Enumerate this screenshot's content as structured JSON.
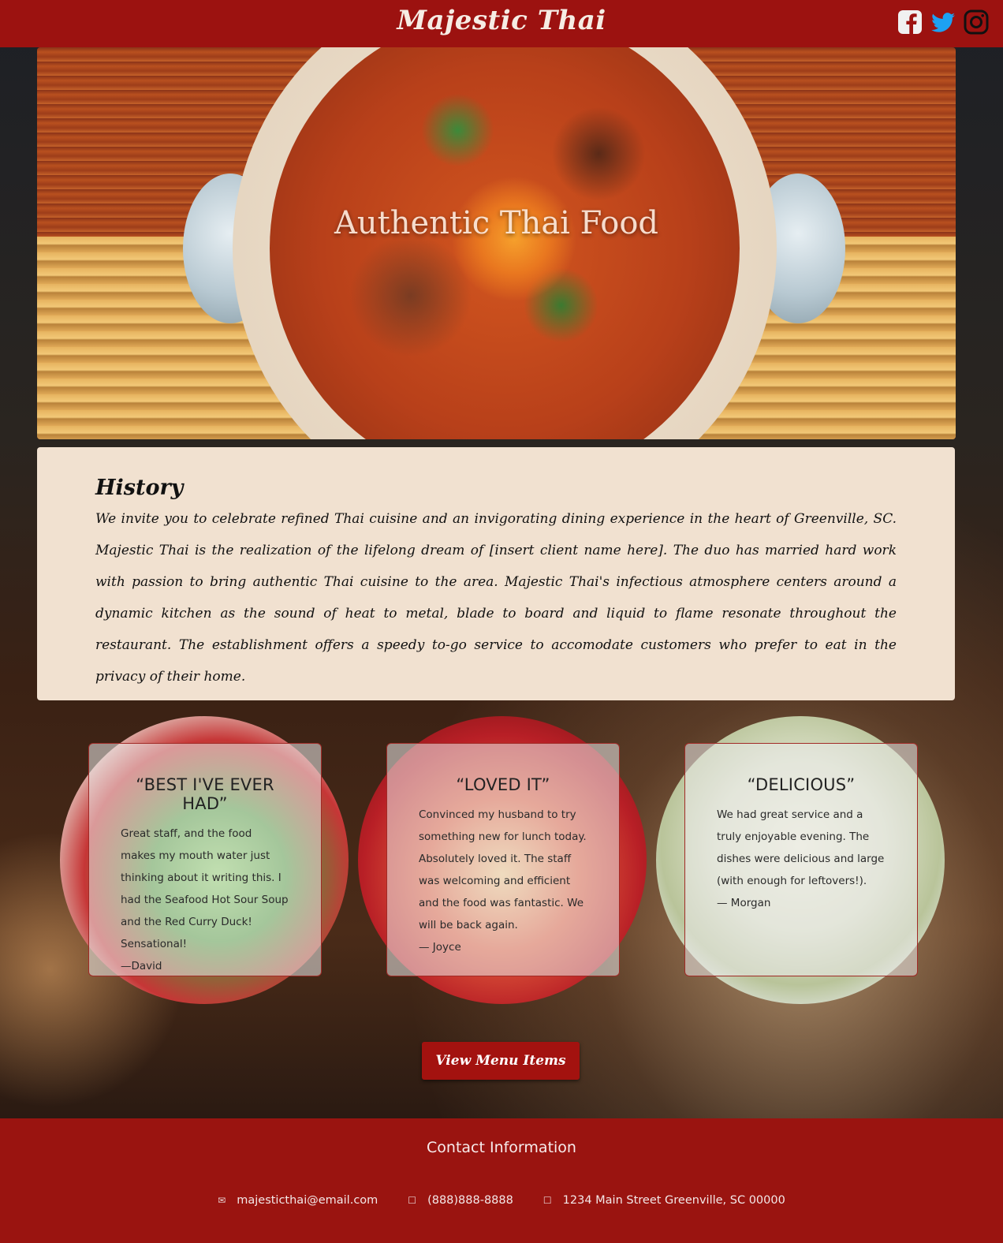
{
  "header": {
    "brand": "Majestic Thai"
  },
  "social": [
    {
      "name": "facebook-icon"
    },
    {
      "name": "twitter-icon"
    },
    {
      "name": "instagram-icon"
    }
  ],
  "hero": {
    "title": "Authentic Thai Food"
  },
  "history": {
    "heading": "History",
    "text": "We invite you to celebrate refined Thai cuisine and an invigorating dining experience in the heart of Greenville, SC. Majestic Thai is the realization of the lifelong dream of [insert client name here]. The duo has married hard work with passion to bring authentic Thai cuisine to the area. Majestic Thai's infectious atmosphere centers around a dynamic kitchen as the sound of heat to metal, blade to board and liquid to flame resonate throughout the restaurant. The establishment offers a speedy to-go service to accomodate customers who prefer to eat in the privacy of their home."
  },
  "reviews": [
    {
      "title": "“BEST I'VE EVER HAD”",
      "body": "Great staff, and the food makes my mouth water just thinking about it writing this. I had the Seafood Hot Sour Soup and the Red Curry Duck! Sensational!",
      "author": "—David"
    },
    {
      "title": "“LOVED IT”",
      "body": "Convinced my husband to try something new for lunch today. Absolutely loved it. The staff was welcoming and efficient and the food was fantastic. We will be back again.",
      "author": "— Joyce"
    },
    {
      "title": "“DELICIOUS”",
      "body": "We had great service and a truly enjoyable evening. The dishes were delicious and large (with enough for leftovers!).",
      "author": "— Morgan"
    }
  ],
  "cta": {
    "label": "View Menu Items"
  },
  "footer": {
    "heading": "Contact Information",
    "email": "majesticthai@email.com",
    "phone": "(888)888-8888",
    "address": "1234 Main Street Greenville, SC 00000"
  }
}
